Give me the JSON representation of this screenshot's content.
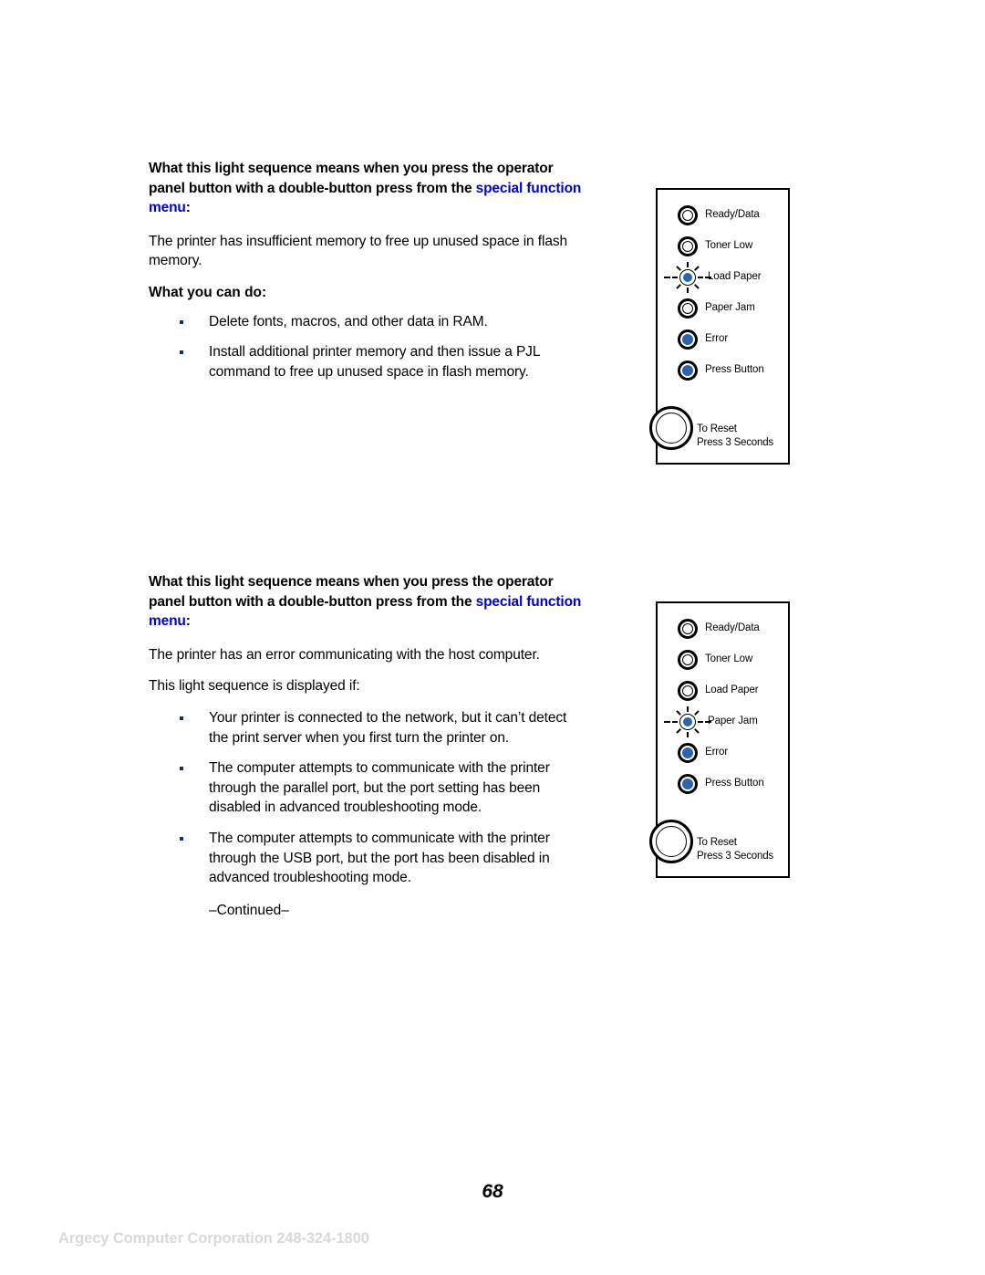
{
  "document": {
    "page_number": "68",
    "footer_watermark": "Argecy Computer Corporation 248-324-1800",
    "link_color": "#0000cc",
    "led_on_color": "#2d63a8",
    "bullet_color": "#1b2a6b",
    "watermark_color": "#d9d9d9"
  },
  "sections": [
    {
      "heading_part1": "What this light sequence means when you press the operator panel button with a double-button press from the ",
      "heading_link": "special function menu",
      "heading_part2": ":",
      "paragraph": "The printer has insufficient memory to free up unused space in flash memory.",
      "subheading": "What you can do:",
      "bullets": [
        "Delete fonts, macros, and other data in RAM.",
        "Install additional printer memory and then issue a PJL command to free up unused space in flash memory."
      ]
    },
    {
      "heading_part1": "What this light sequence means when you press the operator panel button with a double-button press from the ",
      "heading_link": "special function menu",
      "heading_part2": ":",
      "paragraph": "The printer has an error communicating with the host computer.",
      "paragraph2": "This light sequence is displayed if:",
      "bullets": [
        "Your printer is connected to the network, but it can’t detect the print server when you first turn the printer on.",
        "The computer attempts to communicate with the printer through the parallel port, but the port setting has been disabled in advanced troubleshooting mode.",
        "The computer attempts to communicate with the printer through the USB port, but the port has been disabled in advanced troubleshooting mode."
      ],
      "continued": "–Continued–"
    }
  ],
  "panels": [
    {
      "name": "operator-panel-load-paper-blinking",
      "leds": [
        {
          "label": "Ready/Data",
          "state": "off"
        },
        {
          "label": "Toner Low",
          "state": "off"
        },
        {
          "label": "Load Paper",
          "state": "blinking"
        },
        {
          "label": "Paper Jam",
          "state": "off"
        },
        {
          "label": "Error",
          "state": "on"
        },
        {
          "label": "Press Button",
          "state": "on"
        }
      ],
      "button": {
        "line1": "To Reset",
        "line2": "Press 3 Seconds"
      }
    },
    {
      "name": "operator-panel-paper-jam-blinking",
      "leds": [
        {
          "label": "Ready/Data",
          "state": "off"
        },
        {
          "label": "Toner Low",
          "state": "off"
        },
        {
          "label": "Load Paper",
          "state": "off"
        },
        {
          "label": "Paper Jam",
          "state": "blinking"
        },
        {
          "label": "Error",
          "state": "on"
        },
        {
          "label": "Press Button",
          "state": "on"
        }
      ],
      "button": {
        "line1": "To Reset",
        "line2": "Press 3 Seconds"
      }
    }
  ]
}
